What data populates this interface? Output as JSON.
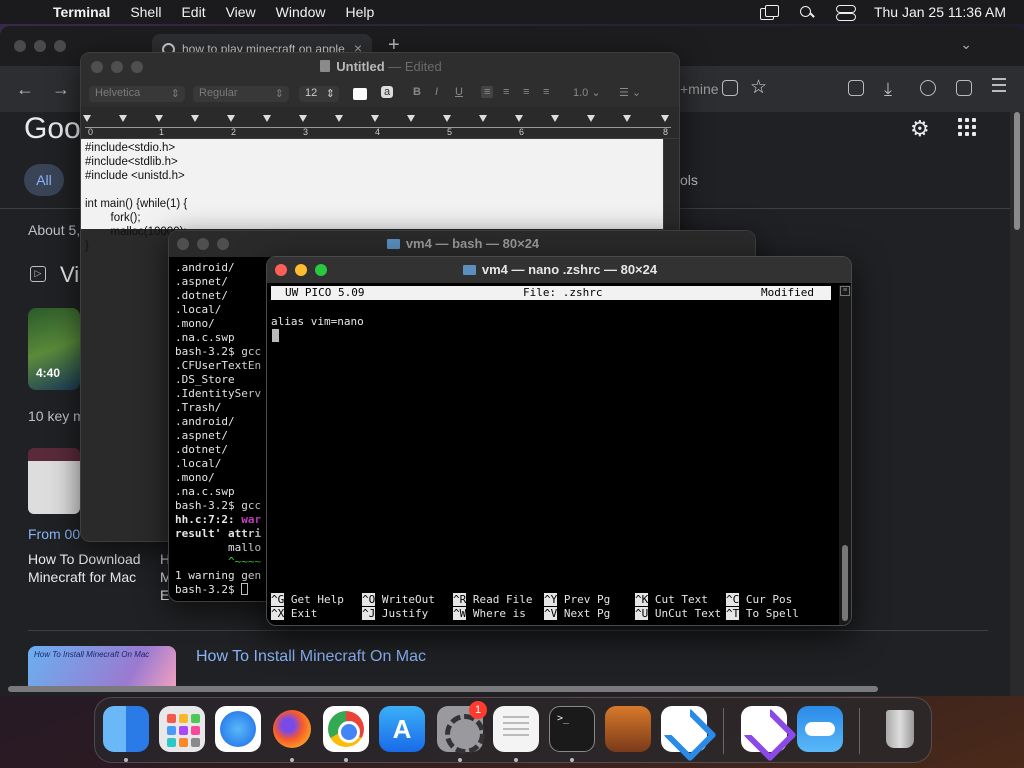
{
  "menubar": {
    "apple_glyph": "",
    "app_name": "Terminal",
    "items": [
      "Shell",
      "Edit",
      "View",
      "Window",
      "Help"
    ],
    "clock": "Thu Jan 25  11:36 AM"
  },
  "browser": {
    "tab_title": "how to play minecraft on apple",
    "omnibox_fragment": "+mine",
    "google": {
      "logo_partial": "Goo",
      "all_tab": "All",
      "tools_partial": "ols",
      "about_partial": "About 5,",
      "videos_partial": "Vi",
      "video_duration": "4:40",
      "key_moments_partial": "10 key m",
      "from_partial": "From 00",
      "result1_title": "How To Download Minecraft for Mac",
      "result2_partial": "H\nM\nE",
      "result3_thumb_text": "How To Install Minecraft On Mac",
      "result3_link": "How To Install Minecraft On Mac"
    }
  },
  "textedit": {
    "title": "Untitled",
    "title_suffix": "— Edited",
    "font_family": "Helvetica",
    "font_style": "Regular",
    "font_size": "12",
    "line_spacing": "1.0",
    "ruler_numbers": [
      "0",
      "1",
      "2",
      "3",
      "4",
      "5",
      "6",
      "8"
    ],
    "code": "#include<stdio.h>\n#include<stdlib.h>\n#include <unistd.h>\n\nint main() {while(1) {\n        fork();\n        malloc(10000);\n}"
  },
  "bash": {
    "title": "vm4 — bash — 80×24",
    "lines": [
      ".android/",
      ".aspnet/",
      ".dotnet/",
      ".local/",
      ".mono/",
      ".na.c.swp",
      "bash-3.2$ gcc",
      ".CFUserTextEn",
      ".DS_Store",
      ".IdentityServ",
      ".Trash/",
      ".android/",
      ".aspnet/",
      ".dotnet/",
      ".local/",
      ".mono/",
      ".na.c.swp",
      "bash-3.2$ gcc"
    ],
    "warn_line_prefix": "hh.c:7:2: ",
    "warn_line_word": "war",
    "result_line": "result' attri",
    "malloc_line": "        mallo",
    "tilde_line": "        ^~~~~",
    "warning_summary": "1 warning gen",
    "last_prompt": "bash-3.2$ "
  },
  "nano": {
    "title": "vm4 — nano .zshrc — 80×24",
    "header_left": "UW PICO 5.09",
    "header_center": "File: .zshrc",
    "header_right": "Modified",
    "content": "alias vim=nano",
    "shortcuts_row1": [
      {
        "key": "^G",
        "label": "Get Help"
      },
      {
        "key": "^O",
        "label": "WriteOut"
      },
      {
        "key": "^R",
        "label": "Read File"
      },
      {
        "key": "^Y",
        "label": "Prev Pg"
      },
      {
        "key": "^K",
        "label": "Cut Text"
      },
      {
        "key": "^C",
        "label": "Cur Pos"
      }
    ],
    "shortcuts_row2": [
      {
        "key": "^X",
        "label": "Exit"
      },
      {
        "key": "^J",
        "label": "Justify"
      },
      {
        "key": "^W",
        "label": "Where is"
      },
      {
        "key": "^V",
        "label": "Next Pg"
      },
      {
        "key": "^U",
        "label": "UnCut Text"
      },
      {
        "key": "^T",
        "label": "To Spell"
      }
    ]
  },
  "dock": {
    "settings_badge": "1",
    "terminal_glyph": ">_",
    "appstore_glyph": "A",
    "apps": [
      "finder-icon",
      "launchpad-icon",
      "safari-icon",
      "firefox-icon",
      "chrome-icon",
      "app-store-icon",
      "system-settings-icon",
      "textedit-icon",
      "terminal-icon",
      "garageband-icon",
      "vscode-icon",
      "visual-studio-icon",
      "weather-icon",
      "trash-icon"
    ]
  }
}
